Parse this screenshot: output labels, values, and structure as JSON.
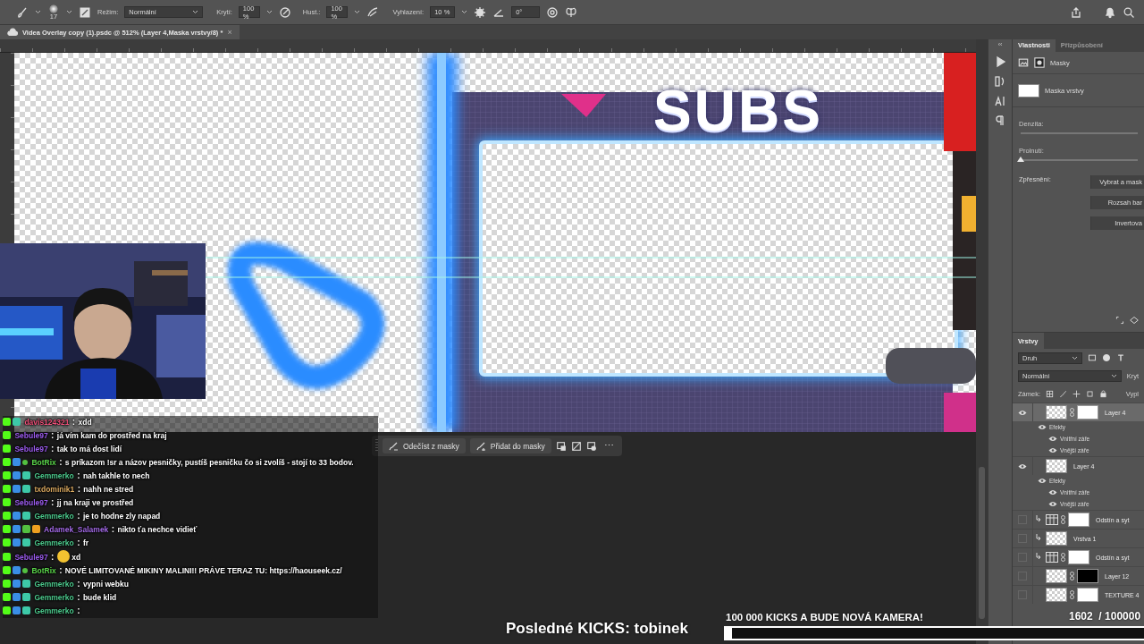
{
  "toolbar": {
    "brush_size": "17",
    "mode_label": "Režim:",
    "mode": "Normální",
    "opacity_label": "Krytí:",
    "opacity": "100 %",
    "flow_label": "Hust.:",
    "flow": "100 %",
    "smoothing_label": "Vyhlazení:",
    "smoothing": "10 %",
    "angle": "0°"
  },
  "document_tab": {
    "title": "Videa Overlay copy (1).psdc @ 512% (Layer 4,Maska vrstvy/8) *",
    "close": "×"
  },
  "canvas": {
    "heading": "SUBS"
  },
  "mask_toolbar": {
    "buttons": [
      "Odečíst z masky",
      "Přidat do masky"
    ],
    "more": "⋯"
  },
  "properties": {
    "collapse": "‹‹",
    "tabs": [
      {
        "label": "Vlastnosti",
        "selected": true
      },
      {
        "label": "Přizpůsobení",
        "selected": false
      }
    ],
    "section": "Masky",
    "mask_label": "Maska vrstvy",
    "sliders": [
      {
        "label": "Denzita:"
      },
      {
        "label": "Prolnutí:",
        "level": 0
      }
    ],
    "refine_label": "Zpřesnění:",
    "buttons": [
      "Vybrat a mask",
      "Rozsah bar",
      "Invertova"
    ]
  },
  "layers": {
    "tab": "Vrstvy",
    "filter": "Druh",
    "blend": "Normální",
    "opacity_label": "Kryt",
    "lock_label": "Zámek:",
    "fill_label": "Vypl",
    "items": [
      {
        "name": "Layer 4",
        "kind": "pixel",
        "visible": true,
        "selected": true,
        "clipped": false,
        "mask": {
          "color": "#ffffff"
        },
        "children": [
          {
            "name": "Efekty",
            "children": [
              {
                "name": "Vnitřní záře"
              },
              {
                "name": "Vnější záře"
              }
            ]
          }
        ]
      },
      {
        "name": "Layer 4",
        "kind": "pixel",
        "visible": true,
        "selected": false,
        "clipped": false,
        "children": [
          {
            "name": "Efekty",
            "children": [
              {
                "name": "Vnitřní záře"
              },
              {
                "name": "Vnější záře"
              }
            ]
          }
        ]
      },
      {
        "name": "Odstín a syt",
        "kind": "adjustment",
        "visible": false,
        "selected": false,
        "clipped": true,
        "mask": {
          "color": "#ffffff"
        }
      },
      {
        "name": "Vrstva 1",
        "kind": "pixel",
        "visible": false,
        "selected": false,
        "clipped": true
      },
      {
        "name": "Odstín a syt",
        "kind": "adjustment",
        "visible": false,
        "selected": false,
        "clipped": true,
        "mask": {
          "color": "#ffffff"
        }
      },
      {
        "name": "Layer 12",
        "kind": "pixel",
        "visible": false,
        "selected": false,
        "clipped": false,
        "mask": {
          "color": "#000000"
        }
      },
      {
        "name": "TEXTURE 4",
        "kind": "pixel",
        "visible": false,
        "selected": false,
        "clipped": false,
        "mask": {
          "color": "#ffffff"
        }
      }
    ]
  },
  "chat": {
    "messages": [
      {
        "badges": [
          {
            "kind": "square",
            "color": "#53fc18"
          },
          {
            "kind": "square",
            "color": "#3dc9a8"
          }
        ],
        "user": "davis124321",
        "color": "#f0507a",
        "separator": ":",
        "text": "xdd",
        "emote": false
      },
      {
        "badges": [
          {
            "kind": "square",
            "color": "#53fc18"
          }
        ],
        "user": "Sebule97",
        "color": "#9d5cf0",
        "separator": ":",
        "text": "já vím kam do prostřed na kraj",
        "emote": false
      },
      {
        "badges": [
          {
            "kind": "square",
            "color": "#53fc18"
          }
        ],
        "user": "Sebule97",
        "color": "#9d5cf0",
        "separator": ":",
        "text": "tak to má dost lidí",
        "emote": false
      },
      {
        "badges": [
          {
            "kind": "square",
            "color": "#53fc18"
          },
          {
            "kind": "square",
            "color": "#3a8ee6"
          },
          {
            "kind": "dot",
            "color": "#53c040"
          }
        ],
        "user": "BotRix",
        "color": "#5bd64b",
        "separator": ":",
        "text": "s príkazom !sr a názov pesničky, pustíš pesničku čo si zvolíš - stojí to 33 bodov.",
        "emote": false
      },
      {
        "badges": [
          {
            "kind": "square",
            "color": "#53fc18"
          },
          {
            "kind": "square",
            "color": "#3a8ee6"
          },
          {
            "kind": "square",
            "color": "#3dc9a8"
          }
        ],
        "user": "Gemmerko",
        "color": "#4cc98c",
        "separator": ":",
        "text": "nah takhle to nech",
        "emote": false
      },
      {
        "badges": [
          {
            "kind": "square",
            "color": "#53fc18"
          },
          {
            "kind": "square",
            "color": "#3a8ee6"
          },
          {
            "kind": "square",
            "color": "#3dc9a8"
          }
        ],
        "user": "txdominik1",
        "color": "#d9a860",
        "separator": ":",
        "text": "nahh ne stred",
        "emote": false
      },
      {
        "badges": [
          {
            "kind": "square",
            "color": "#53fc18"
          }
        ],
        "user": "Sebule97",
        "color": "#9d5cf0",
        "separator": ":",
        "text": "jj na kraji ve prostřed",
        "emote": false
      },
      {
        "badges": [
          {
            "kind": "square",
            "color": "#53fc18"
          },
          {
            "kind": "square",
            "color": "#3a8ee6"
          },
          {
            "kind": "square",
            "color": "#3dc9a8"
          }
        ],
        "user": "Gemmerko",
        "color": "#4cc98c",
        "separator": ":",
        "text": "je to hodne zly napad",
        "emote": false
      },
      {
        "badges": [
          {
            "kind": "square",
            "color": "#53fc18"
          },
          {
            "kind": "square",
            "color": "#3a8ee6"
          },
          {
            "kind": "square",
            "color": "#53c040"
          },
          {
            "kind": "square",
            "color": "#f0a020"
          }
        ],
        "user": "Adamek_Salamek",
        "color": "#a36ae6",
        "separator": ":",
        "text": "nikto ťa nechce vidieť",
        "emote": false
      },
      {
        "badges": [
          {
            "kind": "square",
            "color": "#53fc18"
          },
          {
            "kind": "square",
            "color": "#3a8ee6"
          },
          {
            "kind": "square",
            "color": "#3dc9a8"
          }
        ],
        "user": "Gemmerko",
        "color": "#4cc98c",
        "separator": ":",
        "text": "fr",
        "emote": false
      },
      {
        "badges": [
          {
            "kind": "square",
            "color": "#53fc18"
          }
        ],
        "user": "Sebule97",
        "color": "#9d5cf0",
        "separator": ":",
        "text": "xd",
        "emote": true
      },
      {
        "badges": [
          {
            "kind": "square",
            "color": "#53fc18"
          },
          {
            "kind": "square",
            "color": "#3a8ee6"
          },
          {
            "kind": "dot",
            "color": "#53c040"
          }
        ],
        "user": "BotRix",
        "color": "#5bd64b",
        "separator": ":",
        "text": "NOVÉ LIMITOVANÉ MIKINY MALINI!! PRÁVE TERAZ TU: https://haouseek.cz/",
        "emote": false
      },
      {
        "badges": [
          {
            "kind": "square",
            "color": "#53fc18"
          },
          {
            "kind": "square",
            "color": "#3a8ee6"
          },
          {
            "kind": "square",
            "color": "#3dc9a8"
          }
        ],
        "user": "Gemmerko",
        "color": "#4cc98c",
        "separator": ":",
        "text": "vypni webku",
        "emote": false
      },
      {
        "badges": [
          {
            "kind": "square",
            "color": "#53fc18"
          },
          {
            "kind": "square",
            "color": "#3a8ee6"
          },
          {
            "kind": "square",
            "color": "#3dc9a8"
          }
        ],
        "user": "Gemmerko",
        "color": "#4cc98c",
        "separator": ":",
        "text": "bude klid",
        "emote": false
      },
      {
        "badges": [
          {
            "kind": "square",
            "color": "#53fc18"
          },
          {
            "kind": "square",
            "color": "#3a8ee6"
          },
          {
            "kind": "square",
            "color": "#3dc9a8"
          }
        ],
        "user": "Gemmerko",
        "color": "#4cc98c",
        "separator": ":",
        "emote": false
      }
    ]
  },
  "stream": {
    "latest": "Posledné KICKS: tobinek",
    "goal_title": "100 000 KICKS A BUDE NOVÁ KAMERA!",
    "goal_count": "1602  / 100000",
    "level": 0.016
  }
}
